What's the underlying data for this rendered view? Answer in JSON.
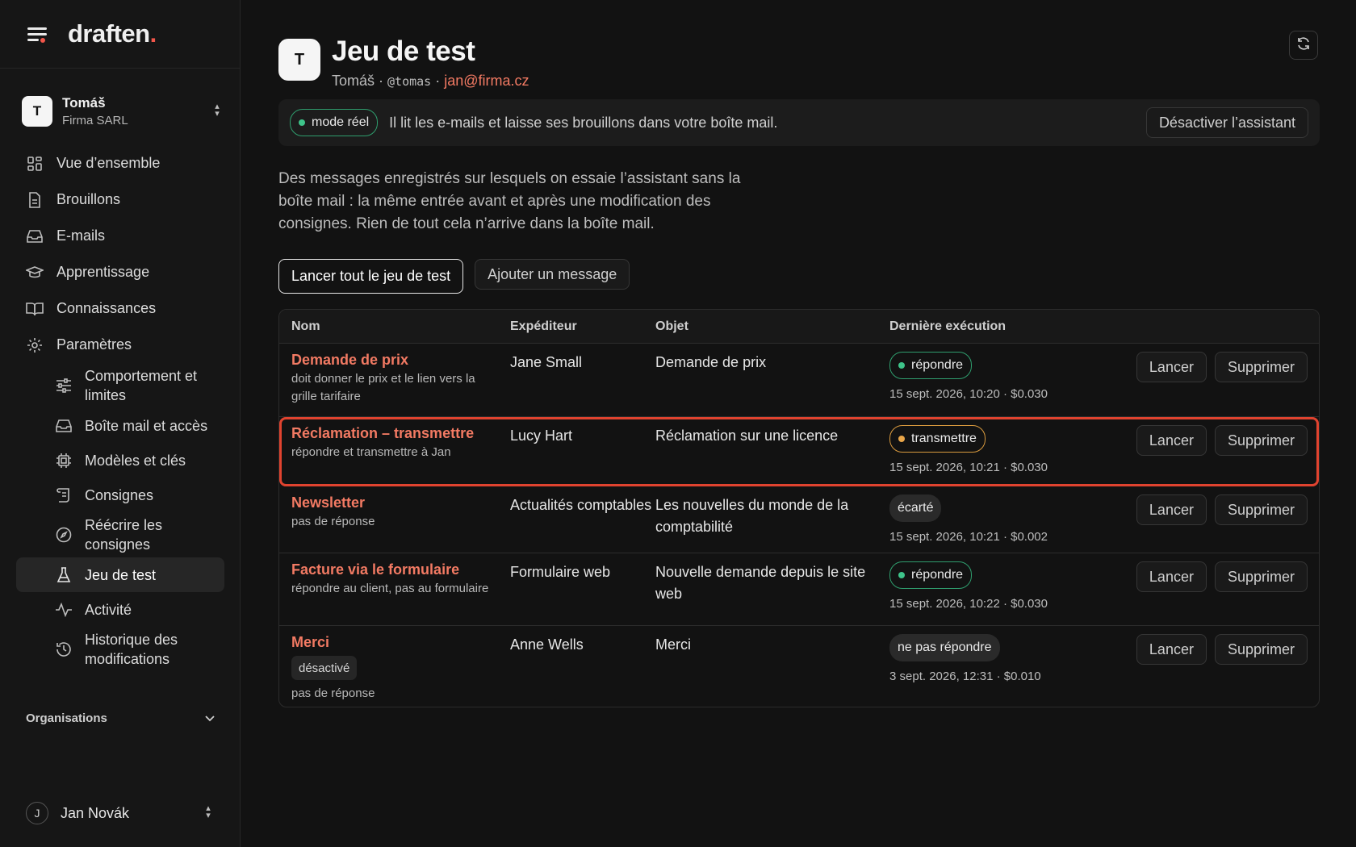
{
  "app": {
    "logo": "draften",
    "logo_dot": "."
  },
  "account": {
    "initial": "T",
    "name": "Tomáš",
    "org": "Firma SARL"
  },
  "nav": {
    "overview": "Vue d’ensemble",
    "drafts": "Brouillons",
    "emails": "E-mails",
    "learning": "Apprentissage",
    "knowledge": "Connaissances",
    "settings": "Paramètres"
  },
  "subnav": {
    "behavior": "Comportement et limites",
    "mailbox": "Boîte mail et accès",
    "models": "Modèles et clés",
    "instructions": "Consignes",
    "rewrite": "Réécrire les consignes",
    "testset": "Jeu de test",
    "activity": "Activité",
    "history": "Historique des modifications"
  },
  "orgs_label": "Organisations",
  "user": {
    "initial": "J",
    "name": "Jan Novák"
  },
  "header": {
    "initial": "T",
    "title": "Jeu de test",
    "name": "Tomáš",
    "sep1": " · ",
    "handle": "@tomas",
    "sep2": " · ",
    "email": "jan@firma.cz"
  },
  "banner": {
    "mode": "mode réel",
    "text": "Il lit les e-mails et laisse ses brouillons dans votre boîte mail.",
    "button": "Désactiver l’assistant"
  },
  "description": "Des messages enregistrés sur lesquels on essaie l’assistant sans la boîte mail : la même entrée avant et après une modification des consignes. Rien de tout cela n’arrive dans la boîte mail.",
  "actions": {
    "run_all": "Lancer tout le jeu de test",
    "add": "Ajouter un message"
  },
  "table": {
    "headers": {
      "name": "Nom",
      "sender": "Expéditeur",
      "subject": "Objet",
      "last_run": "Dernière exécution"
    },
    "run_label": "Lancer",
    "delete_label": "Supprimer",
    "rows": [
      {
        "name": "Demande de prix",
        "note": "doit donner le prix et le lien vers la grille tarifaire",
        "sender": "Jane Small",
        "subject": "Demande de prix",
        "status": "répondre",
        "status_kind": "green",
        "meta": "15 sept. 2026, 10:20 · $0.030"
      },
      {
        "name": "Réclamation – transmettre",
        "note": "répondre et transmettre à Jan",
        "sender": "Lucy Hart",
        "subject": "Réclamation sur une licence",
        "status": "transmettre",
        "status_kind": "orange",
        "meta": "15 sept. 2026, 10:21 · $0.030"
      },
      {
        "name": "Newsletter",
        "note": "pas de réponse",
        "sender": "Actualités comptables",
        "subject": "Les nouvelles du monde de la comptabilité",
        "status": "écarté",
        "status_kind": "grey",
        "meta": "15 sept. 2026, 10:21 · $0.002"
      },
      {
        "name": "Facture via le formulaire",
        "note": "répondre au client, pas au formulaire",
        "sender": "Formulaire web",
        "subject": "Nouvelle demande depuis le site web",
        "status": "répondre",
        "status_kind": "green",
        "meta": "15 sept. 2026, 10:22 · $0.030"
      },
      {
        "name": "Merci",
        "disabled_tag": "désactivé",
        "note": "pas de réponse",
        "sender": "Anne Wells",
        "subject": "Merci",
        "status": "ne pas répondre",
        "status_kind": "grey",
        "meta": "3 sept. 2026, 12:31 · $0.010"
      }
    ]
  },
  "colors": {
    "accent": "#f27a63",
    "brand_dot": "#f2564a",
    "highlight": "#e0432f",
    "ok": "#3ec48a",
    "warn": "#e9a649"
  }
}
